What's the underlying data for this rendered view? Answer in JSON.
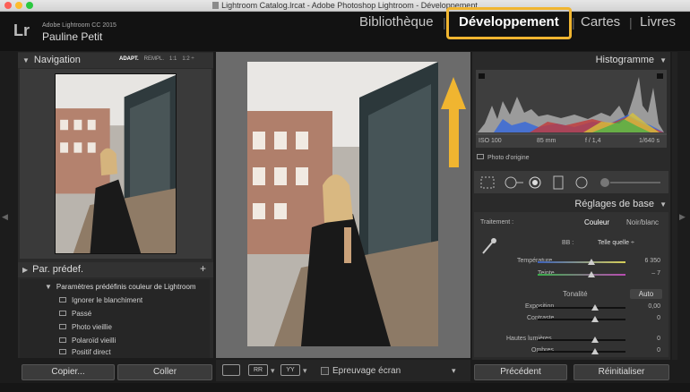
{
  "window": {
    "title": "Lightroom Catalog.lrcat - Adobe Photoshop Lightroom - Développement"
  },
  "identity": {
    "logo": "Lr",
    "app_name": "Adobe Lightroom CC 2015",
    "user_name": "Pauline Petit"
  },
  "modules": [
    {
      "label": "Bibliothèque"
    },
    {
      "label": "Développement"
    },
    {
      "label": "Cartes"
    },
    {
      "label": "Livres"
    }
  ],
  "separator": "|",
  "highlight_color": "#f0b530",
  "navigator": {
    "title": "Navigation",
    "options": [
      "ADAPT.",
      "REMPL.",
      "1:1",
      "1:2 ÷"
    ]
  },
  "presets": {
    "title": "Par. prédef.",
    "add": "+",
    "folder": "Paramètres prédéfinis couleur de Lightroom",
    "items": [
      "Ignorer le blanchiment",
      "Passé",
      "Photo vieillie",
      "Polaroïd vieilli",
      "Positif direct"
    ]
  },
  "left_buttons": {
    "copy": "Copier...",
    "paste": "Coller"
  },
  "toolbar": {
    "grid_a": "RR",
    "grid_b": "YY",
    "softproof": "Epreuvage écran",
    "chevron": "▾"
  },
  "histogram": {
    "title": "Histogramme",
    "iso": "ISO 100",
    "focal": "85 mm",
    "aperture": "f / 1,4",
    "shutter": "1/640 s",
    "original": "Photo d'origine"
  },
  "basic": {
    "title": "Réglages de base",
    "treatment_label": "Traitement :",
    "treatment_color": "Couleur",
    "treatment_bw": "Noir/blanc",
    "wb_label": "BB :",
    "wb_value": "Telle quelle ÷",
    "temperature": {
      "label": "Température",
      "value": "6 350"
    },
    "tint": {
      "label": "Teinte",
      "value": "– 7"
    },
    "tone_label": "Tonalité",
    "auto": "Auto",
    "exposure": {
      "label": "Exposition",
      "value": "0,00"
    },
    "contrast": {
      "label": "Contraste",
      "value": "0"
    },
    "highlights": {
      "label": "Hautes lumières",
      "value": "0"
    },
    "shadows": {
      "label": "Ombres",
      "value": "0"
    }
  },
  "right_buttons": {
    "previous": "Précédent",
    "reset": "Réinitialiser"
  }
}
